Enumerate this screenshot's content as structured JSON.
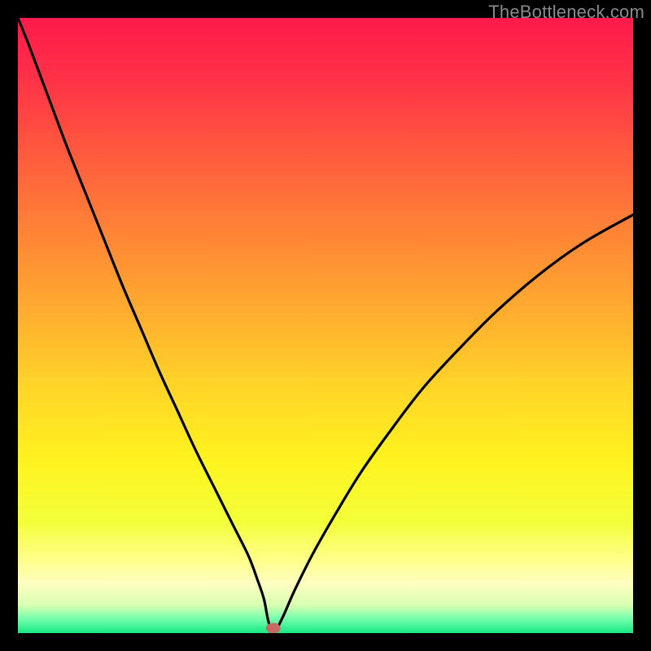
{
  "watermark": "TheBottleneck.com",
  "chart_data": {
    "type": "line",
    "title": "",
    "xlabel": "",
    "ylabel": "",
    "xlim": [
      0,
      100
    ],
    "ylim": [
      0,
      100
    ],
    "x": [
      0,
      2,
      5,
      8,
      11,
      14,
      17,
      20,
      23,
      26,
      29,
      32,
      35,
      37.5,
      39,
      40,
      40.7,
      41.5,
      43,
      45,
      48,
      52,
      56,
      61,
      66,
      72,
      78,
      85,
      92,
      100
    ],
    "y": [
      100,
      95,
      87,
      79,
      71.5,
      64,
      56.5,
      49.5,
      42.5,
      36,
      29.5,
      23.5,
      17.5,
      12.5,
      8.5,
      5.5,
      2,
      0,
      2.5,
      7,
      13,
      20,
      26.5,
      33.5,
      40,
      46.5,
      52.5,
      58.5,
      63.5,
      68
    ],
    "marker": {
      "x": 41.5,
      "y": 0.8
    },
    "gradient_stops": [
      {
        "offset": 0.0,
        "color": "#ff1a4b"
      },
      {
        "offset": 0.1,
        "color": "#ff3247"
      },
      {
        "offset": 0.22,
        "color": "#ff5a3e"
      },
      {
        "offset": 0.35,
        "color": "#ff8436"
      },
      {
        "offset": 0.48,
        "color": "#ffad2f"
      },
      {
        "offset": 0.6,
        "color": "#ffd528"
      },
      {
        "offset": 0.72,
        "color": "#fff31f"
      },
      {
        "offset": 0.82,
        "color": "#f2ff3a"
      },
      {
        "offset": 0.88,
        "color": "#ffff88"
      },
      {
        "offset": 0.92,
        "color": "#fdffc2"
      },
      {
        "offset": 0.955,
        "color": "#d8ffb0"
      },
      {
        "offset": 0.975,
        "color": "#7bffae"
      },
      {
        "offset": 1.0,
        "color": "#17e884"
      }
    ],
    "marker_color": "#c86a63",
    "curve_color": "#000000"
  }
}
